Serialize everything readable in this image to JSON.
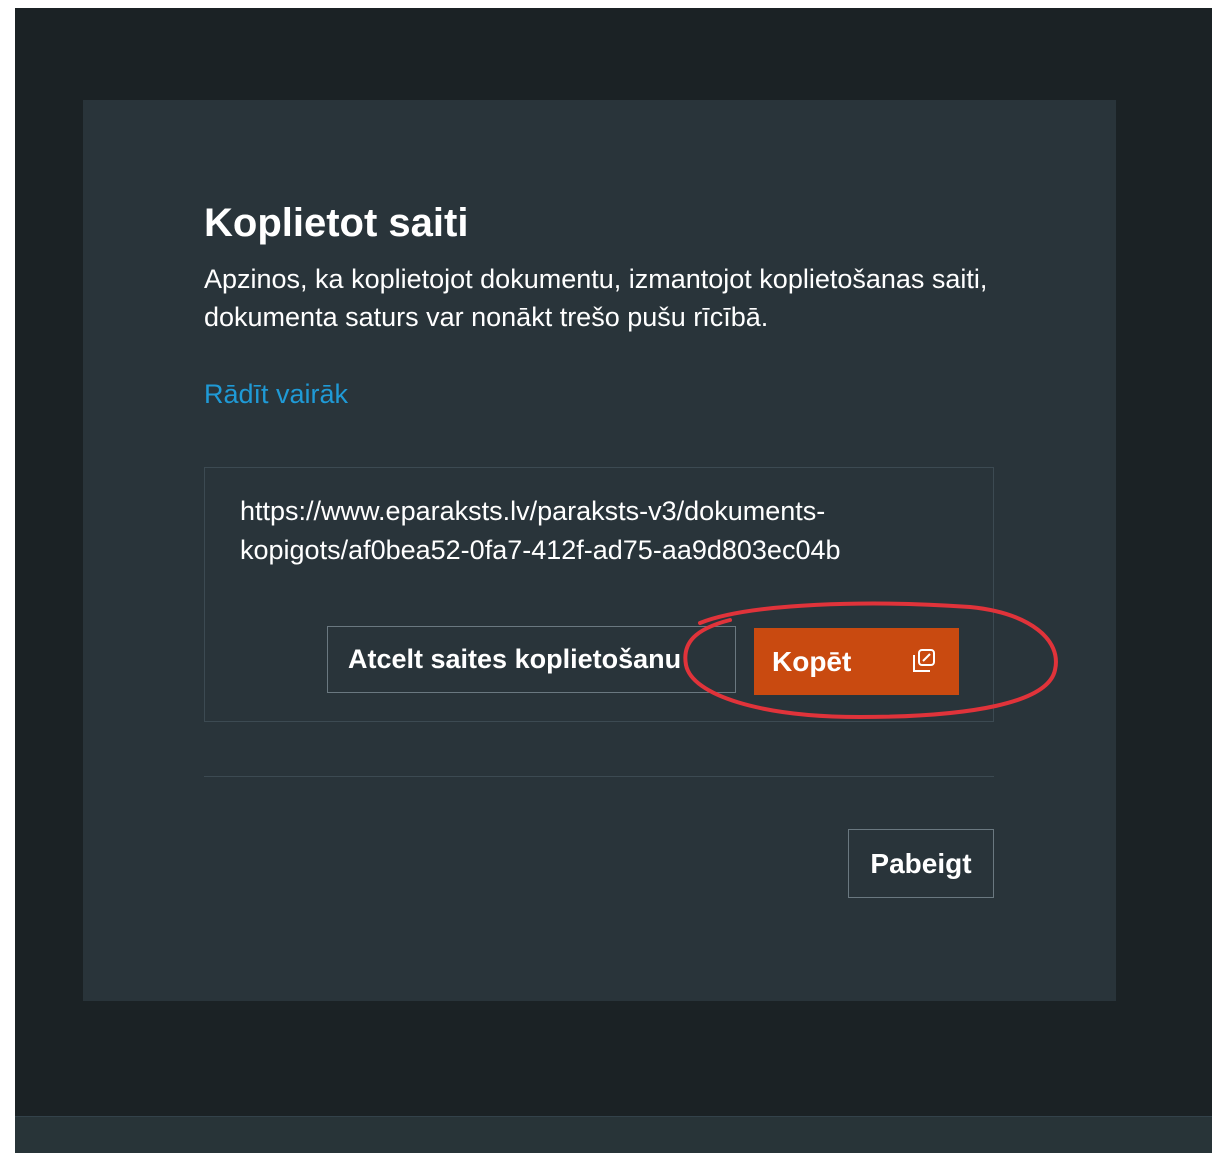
{
  "dialog": {
    "title": "Koplietot saiti",
    "description": "Apzinos, ka koplietojot dokumentu, izmantojot koplietošanas saiti, dokumenta saturs var nonākt trešo pušu rīcībā.",
    "show_more_link": "Rādīt vairāk",
    "share_url": "https://www.eparaksts.lv/paraksts-v3/dokuments-kopigots/af0bea52-0fa7-412f-ad75-aa9d803ec04b",
    "cancel_share_button": "Atcelt saites koplietošanu",
    "copy_button": "Kopēt",
    "copy_icon": "copy-link-icon",
    "finish_button": "Pabeigt"
  },
  "colors": {
    "backdrop": "#1b2225",
    "dialog_bg": "#29343a",
    "accent": "#c94a10",
    "link": "#1f9ad6",
    "annotation": "#e0333a"
  }
}
